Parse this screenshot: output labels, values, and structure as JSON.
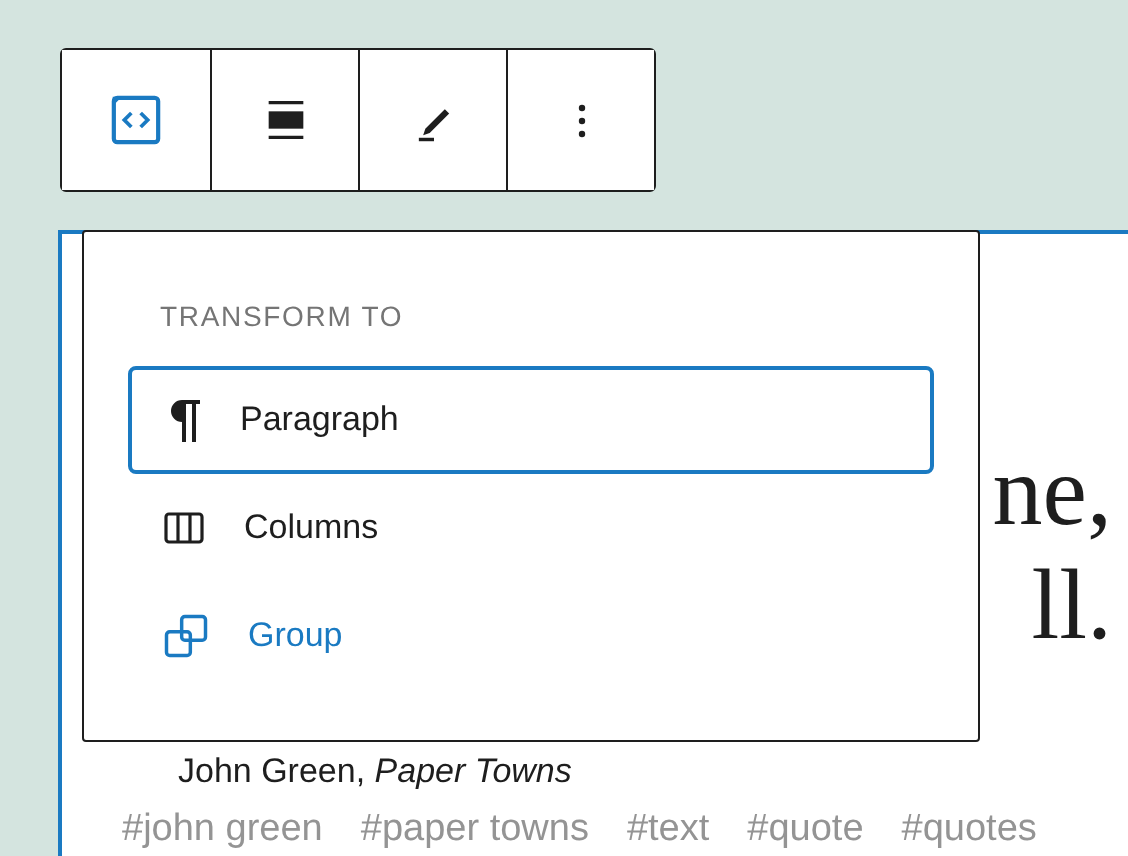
{
  "toolbar": {
    "buttons": [
      {
        "kind": "html",
        "selected": true
      },
      {
        "kind": "align",
        "selected": false
      },
      {
        "kind": "edit",
        "selected": false
      },
      {
        "kind": "more",
        "selected": false
      }
    ]
  },
  "popover": {
    "heading": "TRANSFORM TO",
    "items": [
      {
        "label": "Paragraph",
        "kind": "paragraph",
        "focused": true,
        "hovered": false
      },
      {
        "label": "Columns",
        "kind": "columns",
        "focused": false,
        "hovered": false
      },
      {
        "label": "Group",
        "kind": "group",
        "focused": false,
        "hovered": true
      }
    ]
  },
  "quote": {
    "lines": [
      "ne,",
      "ll."
    ],
    "citation": "John Green, *Paper Towns*"
  },
  "tags": [
    "#john green",
    "#paper towns",
    "#text",
    "#quote",
    "#quotes"
  ]
}
